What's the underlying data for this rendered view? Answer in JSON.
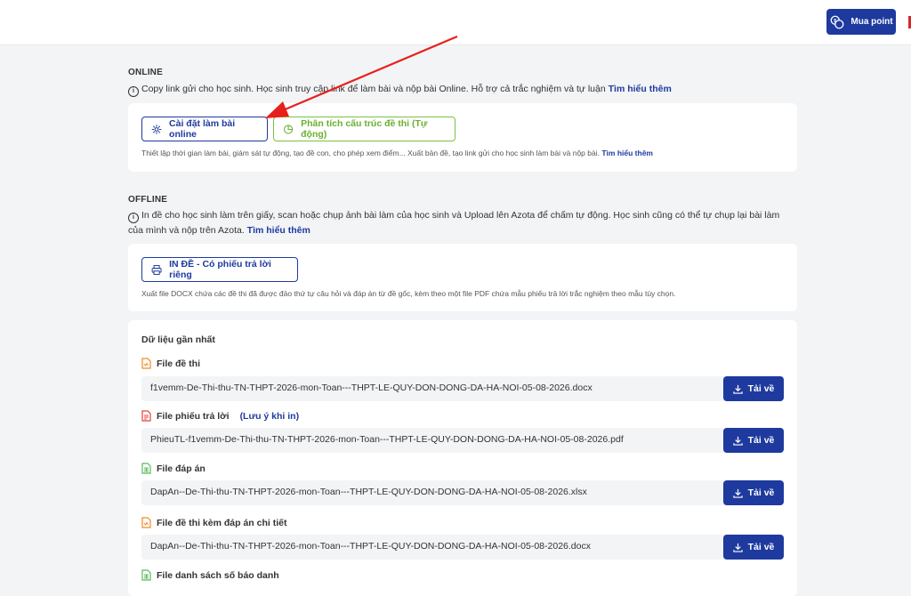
{
  "header": {
    "buy_point_label": "Mua point"
  },
  "online": {
    "title": "ONLINE",
    "info": "Copy link gửi cho học sinh. Học sinh truy cập link để làm bài và nộp bài Online. Hỗ trợ cả trắc nghiệm và tự luận",
    "info_link": "Tìm hiểu thêm",
    "setup_button": "Cài đặt làm bài online",
    "analyze_button": "Phân tích cấu trúc đề thi (Tự động)",
    "desc": "Thiết lập thời gian làm bài, giám sát tự động, tạo đề con, cho phép xem điểm... Xuất bản đề, tạo link gửi cho học sinh làm bài và nộp bài.",
    "desc_link": "Tìm hiểu thêm"
  },
  "offline": {
    "title": "OFFLINE",
    "info": "In đề cho học sinh làm trên giấy, scan hoặc chụp ảnh bài làm của học sinh và Upload lên Azota để chấm tự động. Học sinh cũng có thể tự chụp lại bài làm của mình và nộp trên Azota.",
    "info_link": "Tìm hiểu thêm",
    "print_button": "IN ĐỀ - Có phiếu trả lời riêng",
    "desc": "Xuất file DOCX chứa các đề thi đã được đảo thứ tự câu hỏi và đáp án từ đề gốc, kèm theo một file PDF chứa mẫu phiếu trả lời trắc nghiệm theo mẫu tùy chọn."
  },
  "recent": {
    "title": "Dữ liệu gần nhất",
    "download_label": "Tải về",
    "files": [
      {
        "label": "File đề thi",
        "note": "",
        "name": "f1vemm-De-Thi-thu-TN-THPT-2026-mon-Toan---THPT-LE-QUY-DON-DONG-DA-HA-NOI-05-08-2026.docx",
        "color": "#f08a24"
      },
      {
        "label": "File phiếu trả lời",
        "note": "(Lưu ý khi in)",
        "name": "PhieuTL-f1vemm-De-Thi-thu-TN-THPT-2026-mon-Toan---THPT-LE-QUY-DON-DONG-DA-HA-NOI-05-08-2026.pdf",
        "color": "#e0433a"
      },
      {
        "label": "File đáp án",
        "note": "",
        "name": "DapAn--De-Thi-thu-TN-THPT-2026-mon-Toan---THPT-LE-QUY-DON-DONG-DA-HA-NOI-05-08-2026.xlsx",
        "color": "#5cb85c"
      },
      {
        "label": "File đề thi kèm đáp án chi tiết",
        "note": "",
        "name": "DapAn--De-Thi-thu-TN-THPT-2026-mon-Toan---THPT-LE-QUY-DON-DONG-DA-HA-NOI-05-08-2026.docx",
        "color": "#f08a24"
      },
      {
        "label": "File danh sách số báo danh",
        "note": "",
        "name": "",
        "color": "#5cb85c"
      }
    ]
  },
  "colors": {
    "primary": "#1e3a9e",
    "green": "#7cc142",
    "annotation_arrow": "#e8201c"
  }
}
